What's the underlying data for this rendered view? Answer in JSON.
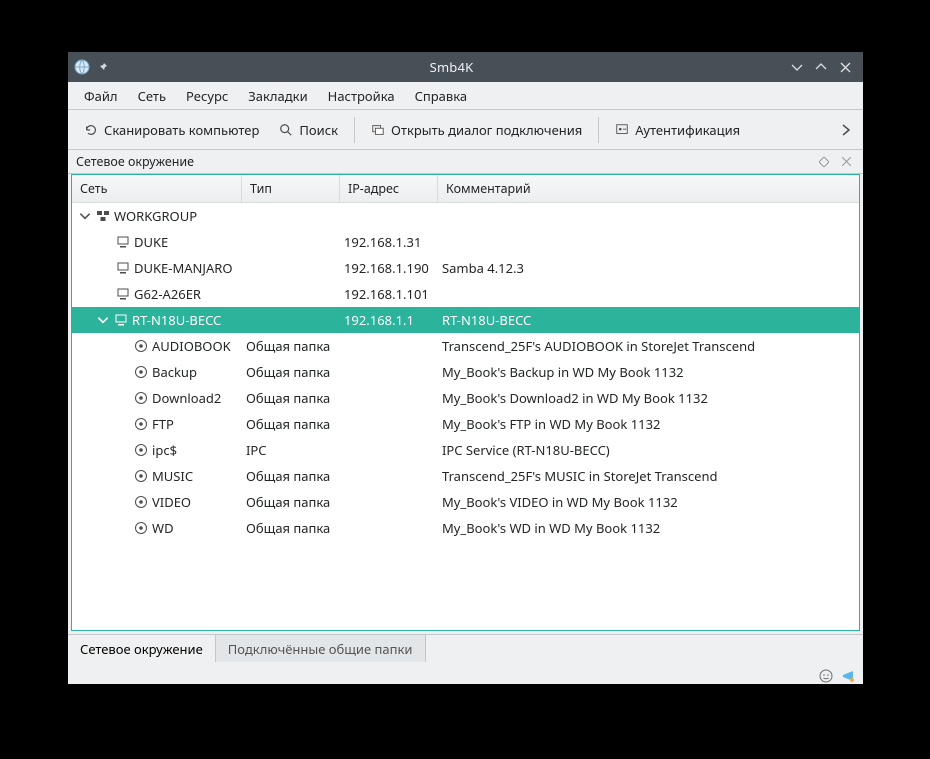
{
  "title": "Smb4K",
  "menu": {
    "file": "Файл",
    "network": "Сеть",
    "resource": "Ресурс",
    "bookmarks": "Закладки",
    "settings": "Настройка",
    "help": "Справка"
  },
  "toolbar": {
    "scan": "Сканировать компьютер",
    "search": "Поиск",
    "mount": "Открыть диалог подключения",
    "auth": "Аутентификация"
  },
  "panel": {
    "title": "Сетевое окружение"
  },
  "columns": {
    "network": "Сеть",
    "type": "Тип",
    "ip": "IP-адрес",
    "comment": "Комментарий"
  },
  "workgroup": {
    "name": "WORKGROUP"
  },
  "hosts": {
    "duke": {
      "name": "DUKE",
      "ip": "192.168.1.31"
    },
    "dukem": {
      "name": "DUKE-MANJARO",
      "ip": "192.168.1.190",
      "comment": "Samba 4.12.3"
    },
    "g62": {
      "name": "G62-A26ER",
      "ip": "192.168.1.101"
    },
    "rt": {
      "name": "RT-N18U-BECC",
      "ip": "192.168.1.1",
      "comment": "RT-N18U-BECC"
    }
  },
  "shares": {
    "type_common": "Общая папка",
    "type_ipc": "IPC",
    "audiobook": {
      "name": "AUDIOBOOK",
      "comment": "Transcend_25F's AUDIOBOOK in StoreJet Transcend"
    },
    "backup": {
      "name": "Backup",
      "comment": "My_Book's Backup in WD My Book 1132"
    },
    "download2": {
      "name": "Download2",
      "comment": "My_Book's Download2 in WD My Book 1132"
    },
    "ftp": {
      "name": "FTP",
      "comment": "My_Book's FTP in WD My Book 1132"
    },
    "ipc": {
      "name": "ipc$",
      "comment": "IPC Service (RT-N18U-BECC)"
    },
    "music": {
      "name": "MUSIC",
      "comment": "Transcend_25F's MUSIC in StoreJet Transcend"
    },
    "video": {
      "name": "VIDEO",
      "comment": "My_Book's VIDEO in WD My Book 1132"
    },
    "wd": {
      "name": "WD",
      "comment": "My_Book's WD in WD My Book 1132"
    }
  },
  "bottom_tabs": {
    "net": "Сетевое окружение",
    "mounted": "Подключённые общие папки"
  },
  "col_widths": {
    "net": 170,
    "type": 98,
    "ip": 98
  }
}
